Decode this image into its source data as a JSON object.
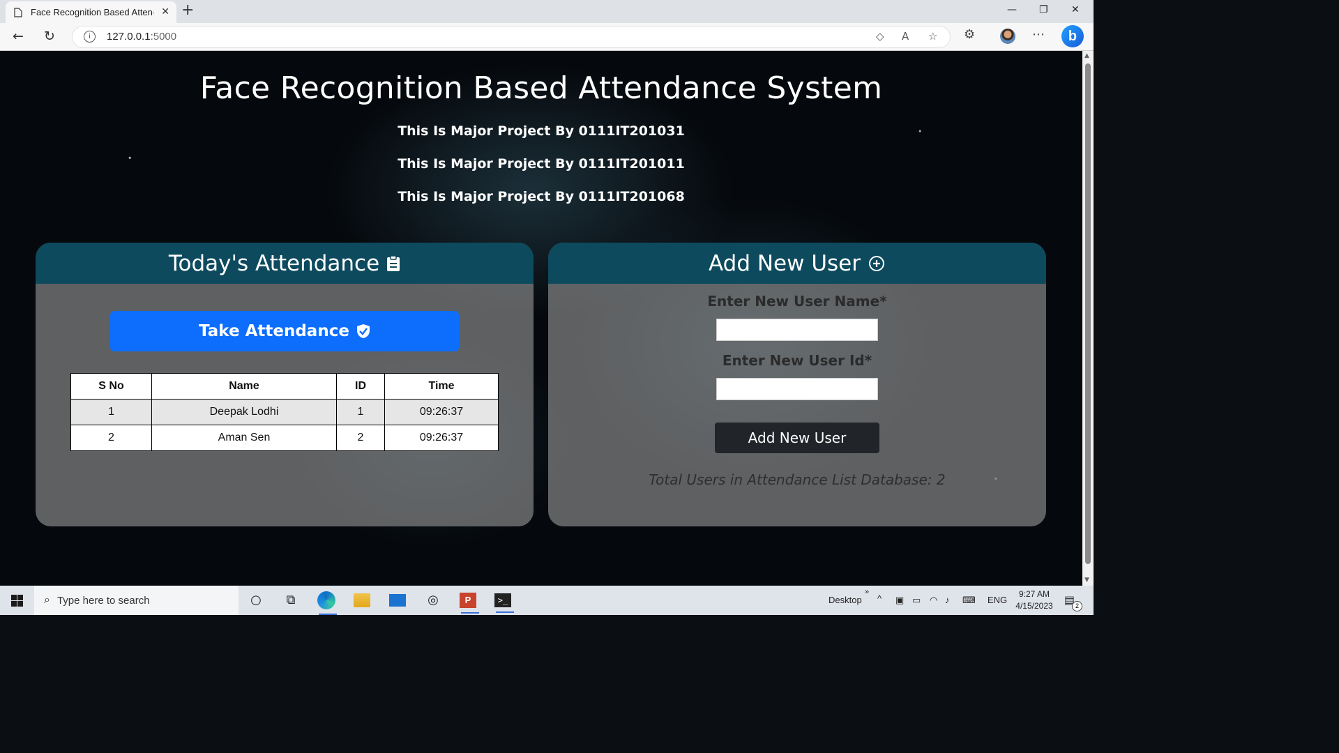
{
  "browser": {
    "tab_title": "Face Recognition Based Attendar",
    "url_host": "127.0.0.1",
    "url_port": ":5000",
    "tab_close": "✕",
    "new_tab": "+"
  },
  "page": {
    "title": "Face Recognition Based Attendance System",
    "subtitles": [
      "This Is Major Project By 0111IT201031",
      "This Is Major Project By 0111IT201011",
      "This Is Major Project By 0111IT201068"
    ]
  },
  "attendance": {
    "heading": "Today's Attendance",
    "button_label": "Take Attendance",
    "columns": [
      "S No",
      "Name",
      "ID",
      "Time"
    ],
    "rows": [
      [
        "1",
        "Deepak Lodhi",
        "1",
        "09:26:37"
      ],
      [
        "2",
        "Aman Sen",
        "2",
        "09:26:37"
      ]
    ]
  },
  "add_user": {
    "heading": "Add New User",
    "name_label": "Enter New User Name*",
    "id_label": "Enter New User Id*",
    "name_value": "",
    "id_value": "",
    "button_label": "Add New User",
    "total_text": "Total Users in Attendance List Database: 2"
  },
  "taskbar": {
    "search_placeholder": "Type here to search",
    "desktop_label": "Desktop",
    "lang": "ENG",
    "time": "9:27 AM",
    "date": "4/15/2023",
    "notifications": "2"
  },
  "colors": {
    "header_teal": "#0d4a5e",
    "primary_button": "#0d6efd",
    "dark_button": "#212529"
  }
}
